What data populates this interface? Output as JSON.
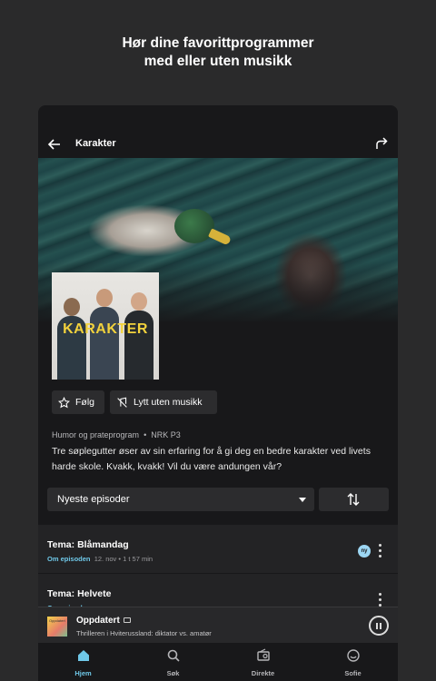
{
  "promo": {
    "line1": "Hør dine favorittprogrammer",
    "line2": "med eller uten musikk"
  },
  "header": {
    "title": "Karakter",
    "back_icon": "arrow-left-icon",
    "share_icon": "share-icon"
  },
  "cover": {
    "text": "KARAKTER"
  },
  "actions": {
    "follow_label": "Følg",
    "listen_label": "Lytt uten musikk"
  },
  "meta": {
    "category": "Humor og prateprogram",
    "separator": "•",
    "channel": "NRK P3"
  },
  "description": "Tre søplegutter øser av sin erfaring for å gi deg en bedre karakter ved livets harde skole. Kvakk, kvakk! Vil du være andungen vår?",
  "episode_filter": {
    "selected": "Nyeste episoder"
  },
  "episodes": [
    {
      "title": "Tema: Blåmandag",
      "link": "Om episoden",
      "date": "12. nov",
      "sep": "•",
      "duration": "1 t 57 min",
      "badge": "ny"
    },
    {
      "title": "Tema: Helvete",
      "link": "Om episoden",
      "date": "",
      "sep": "",
      "duration": "",
      "badge": ""
    }
  ],
  "mini_player": {
    "thumb_text": "Oppdatert",
    "title": "Oppdatert",
    "subtitle": "Thrilleren i Hviterussland: diktator vs. amatør"
  },
  "nav": {
    "items": [
      {
        "label": "Hjem",
        "icon": "home-icon"
      },
      {
        "label": "Søk",
        "icon": "search-icon"
      },
      {
        "label": "Direkte",
        "icon": "radio-icon"
      },
      {
        "label": "Sofie",
        "icon": "smiley-icon"
      }
    ]
  },
  "colors": {
    "accent": "#6fc8e8",
    "background": "#2a2a2b",
    "surface": "#18181a"
  }
}
